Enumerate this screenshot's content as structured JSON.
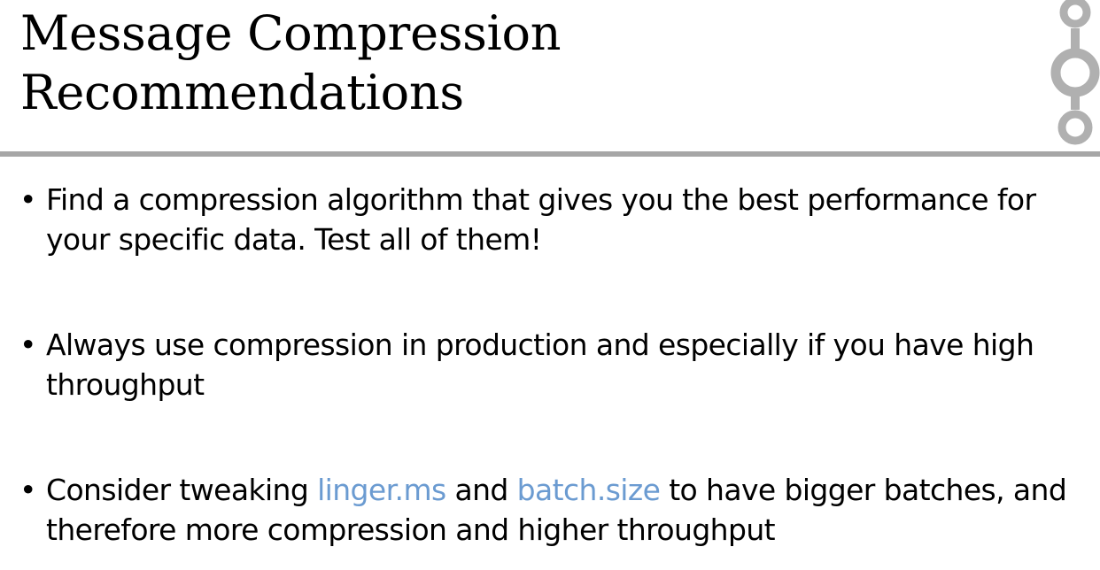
{
  "slide": {
    "title_line1": "Message Compression",
    "title_line2": "Recommendations",
    "colors": {
      "rule": "#a6a6a6",
      "logo": "#b0b0b0",
      "highlight": "#6b9bd1",
      "text": "#000000"
    },
    "logo_icon": "kafka-logo-icon",
    "bullets": [
      {
        "text": "Find a compression algorithm that gives you the best performance for your specific data. Test all of them!"
      },
      {
        "text": "Always use compression in production and especially if you have high throughput"
      },
      {
        "text_before": "Consider tweaking ",
        "highlight1": "linger.ms",
        "text_middle": " and ",
        "highlight2": "batch.size",
        "text_after": " to have bigger batches, and therefore more compression and higher throughput"
      }
    ]
  }
}
